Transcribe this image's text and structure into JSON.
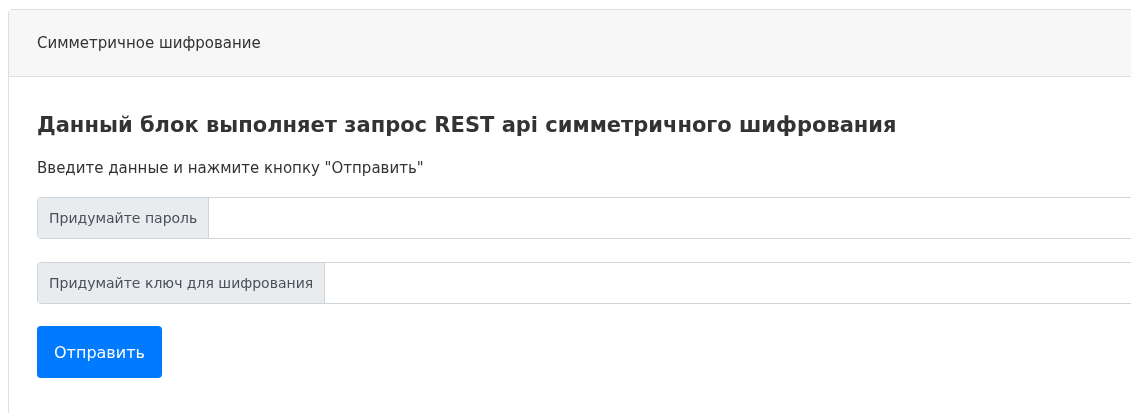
{
  "card": {
    "header": "Симметричное шифрование"
  },
  "heading": "Данный блок выполняет запрос REST api симметричного шифрования",
  "instruction": "Введите данные и нажмите кнопку \"Отправить\"",
  "fields": [
    {
      "label": "Придумайте пароль"
    },
    {
      "label": "Придумайте ключ для шифрования"
    }
  ],
  "submit_button": "Отправить"
}
